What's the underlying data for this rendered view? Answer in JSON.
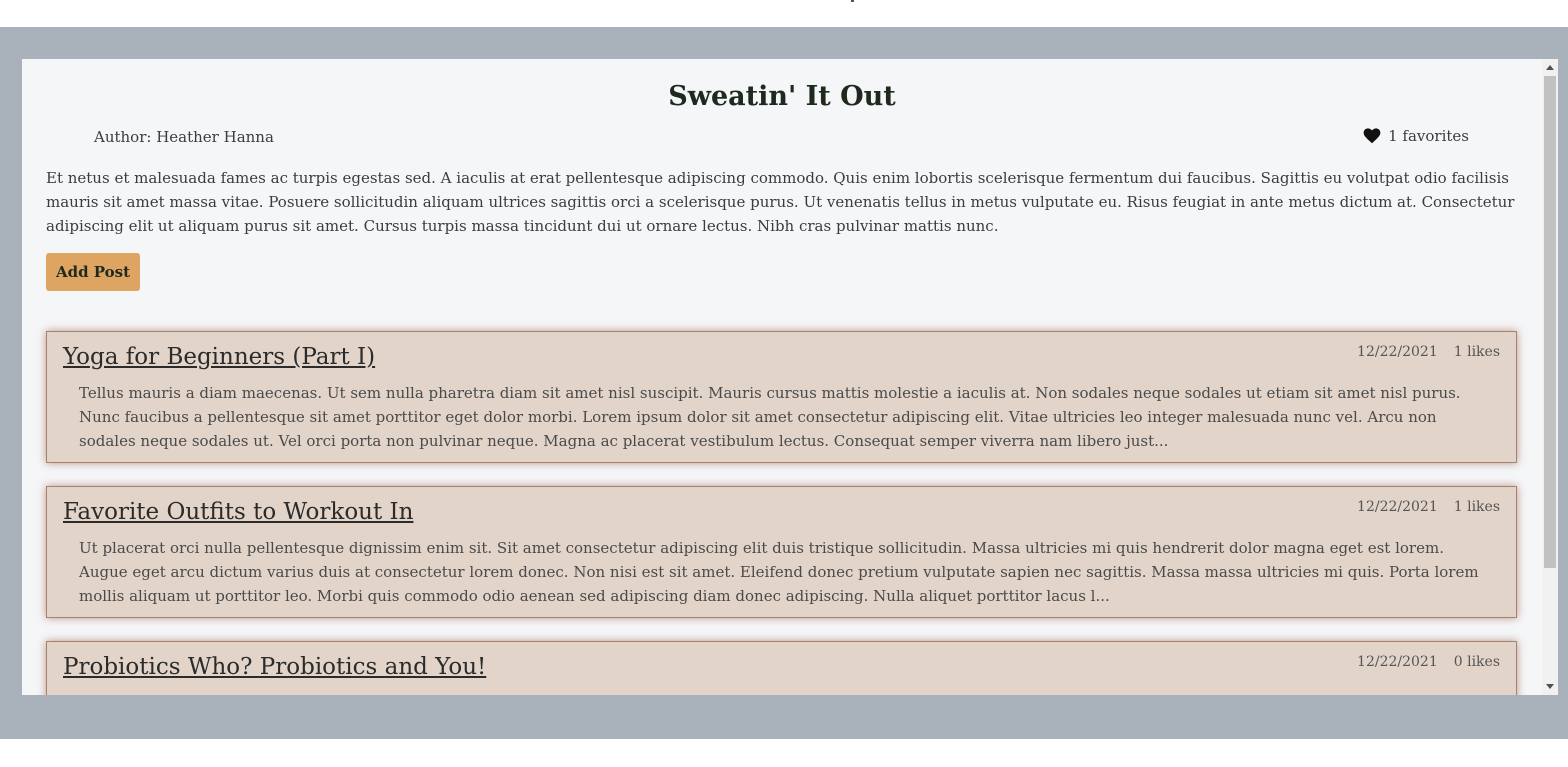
{
  "blog": {
    "title": "Sweatin' It Out",
    "author": "Author: Heather Hanna",
    "favorites": "1 favorites",
    "description": "Et netus et malesuada fames ac turpis egestas sed. A iaculis at erat pellentesque adipiscing commodo. Quis enim lobortis scelerisque fermentum dui faucibus. Sagittis eu volutpat odio facilisis mauris sit amet massa vitae. Posuere sollicitudin aliquam ultrices sagittis orci a scelerisque purus. Ut venenatis tellus in metus vulputate eu. Risus feugiat in ante metus dictum at. Consectetur adipiscing elit ut aliquam purus sit amet. Cursus turpis massa tincidunt dui ut ornare lectus. Nibh cras pulvinar mattis nunc.",
    "add_post_label": "Add Post"
  },
  "posts": [
    {
      "title": "Yoga for Beginners (Part I)",
      "date": "12/22/2021",
      "likes": "1 likes",
      "excerpt": "Tellus mauris a diam maecenas. Ut sem nulla pharetra diam sit amet nisl suscipit. Mauris cursus mattis molestie a iaculis at. Non sodales neque sodales ut etiam sit amet nisl purus. Nunc faucibus a pellentesque sit amet porttitor eget dolor morbi. Lorem ipsum dolor sit amet consectetur adipiscing elit. Vitae ultricies leo integer malesuada nunc vel. Arcu non sodales neque sodales ut. Vel orci porta non pulvinar neque. Magna ac placerat vestibulum lectus. Consequat semper viverra nam libero just..."
    },
    {
      "title": "Favorite Outfits to Workout In",
      "date": "12/22/2021",
      "likes": "1 likes",
      "excerpt": "Ut placerat orci nulla pellentesque dignissim enim sit. Sit amet consectetur adipiscing elit duis tristique sollicitudin. Massa ultricies mi quis hendrerit dolor magna eget est lorem. Augue eget arcu dictum varius duis at consectetur lorem donec. Non nisi est sit amet. Eleifend donec pretium vulputate sapien nec sagittis. Massa massa ultricies mi quis. Porta lorem mollis aliquam ut porttitor leo. Morbi quis commodo odio aenean sed adipiscing diam donec adipiscing. Nulla aliquet porttitor lacus l..."
    },
    {
      "title": "Probiotics Who? Probiotics and You!",
      "date": "12/22/2021",
      "likes": "0 likes",
      "excerpt": ""
    }
  ],
  "icons": {
    "favorite": "heart-icon",
    "scroll_up": "chevron-up-icon",
    "scroll_down": "chevron-down-icon"
  },
  "colors": {
    "page_backdrop": "#a9b2bb",
    "panel_background": "#f5f6f8",
    "card_background": "#e2d4c9",
    "card_border": "#a9806a",
    "button_background": "#dea462",
    "heading_text": "#1f2a1f"
  }
}
